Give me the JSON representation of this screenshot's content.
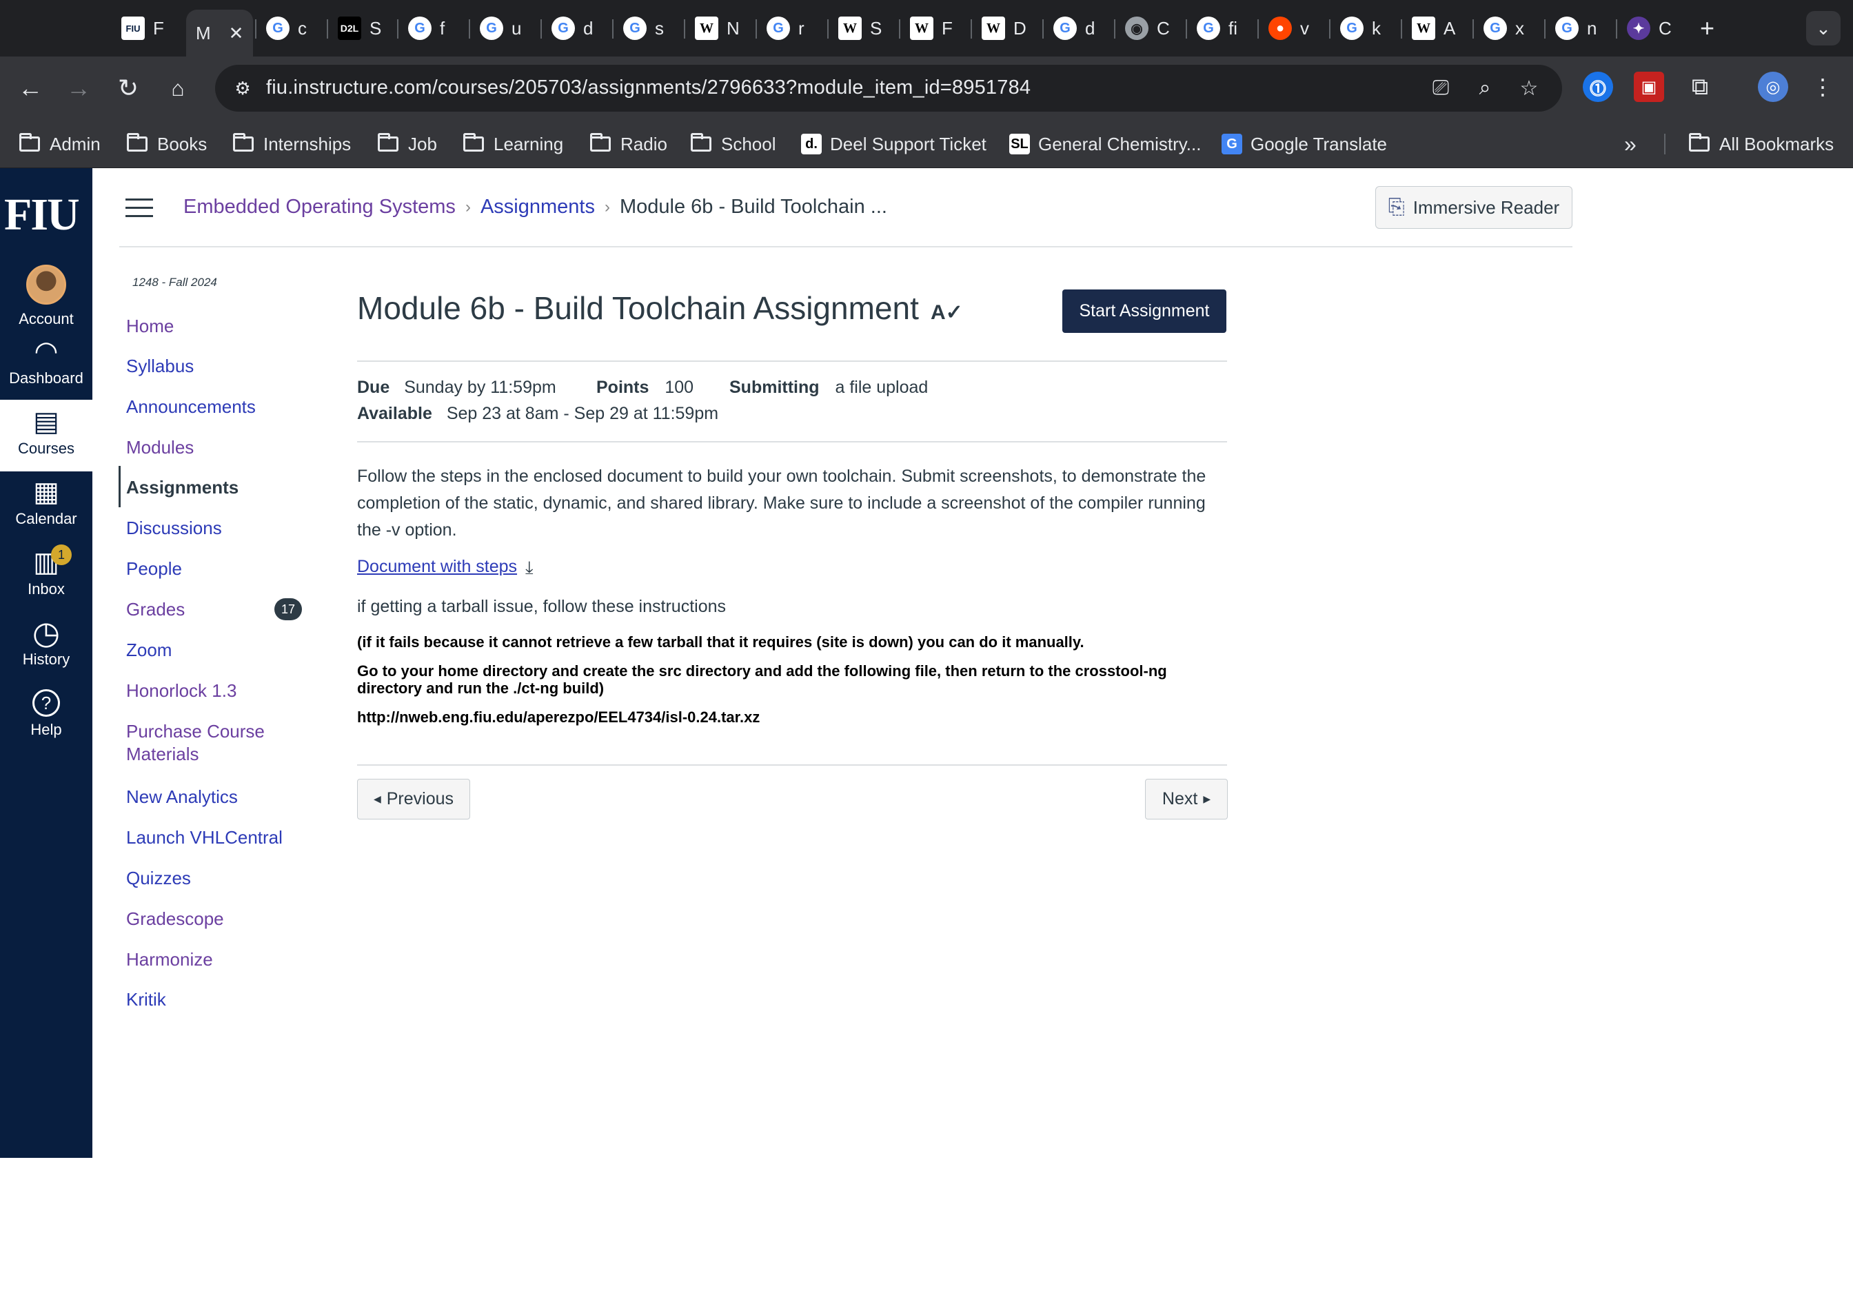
{
  "browser": {
    "tabs": [
      {
        "fav": "FIU",
        "type": "fiu",
        "letter": "F"
      },
      {
        "fav": "",
        "type": "active",
        "letter": "M"
      },
      {
        "fav": "G",
        "type": "g",
        "letter": "c"
      },
      {
        "fav": "D2L",
        "type": "d2l",
        "letter": "S"
      },
      {
        "fav": "G",
        "type": "g",
        "letter": "f"
      },
      {
        "fav": "G",
        "type": "g",
        "letter": "u"
      },
      {
        "fav": "G",
        "type": "g",
        "letter": "d"
      },
      {
        "fav": "G",
        "type": "g",
        "letter": "s"
      },
      {
        "fav": "W",
        "type": "w",
        "letter": "N"
      },
      {
        "fav": "G",
        "type": "g",
        "letter": "r"
      },
      {
        "fav": "W",
        "type": "w",
        "letter": "S"
      },
      {
        "fav": "W",
        "type": "w",
        "letter": "F"
      },
      {
        "fav": "W",
        "type": "w",
        "letter": "D"
      },
      {
        "fav": "G",
        "type": "g",
        "letter": "d"
      },
      {
        "fav": "◉",
        "type": "globe",
        "letter": "C"
      },
      {
        "fav": "G",
        "type": "g",
        "letter": "fi"
      },
      {
        "fav": "●",
        "type": "r",
        "letter": "v"
      },
      {
        "fav": "G",
        "type": "g",
        "letter": "k"
      },
      {
        "fav": "W",
        "type": "w",
        "letter": "A"
      },
      {
        "fav": "G",
        "type": "g",
        "letter": "x"
      },
      {
        "fav": "G",
        "type": "g",
        "letter": "n"
      },
      {
        "fav": "✦",
        "type": "purple",
        "letter": "C"
      }
    ],
    "new_tab": "+",
    "tab_menu": "⌄",
    "url": "fiu.instructure.com/courses/205703/assignments/2796633?module_item_id=8951784",
    "bookmarks": [
      {
        "label": "Admin",
        "kind": "folder"
      },
      {
        "label": "Books",
        "kind": "folder"
      },
      {
        "label": "Internships",
        "kind": "folder"
      },
      {
        "label": "Job",
        "kind": "folder"
      },
      {
        "label": "Learning",
        "kind": "folder"
      },
      {
        "label": "Radio",
        "kind": "folder"
      },
      {
        "label": "School",
        "kind": "folder"
      },
      {
        "label": "Deel Support Ticket",
        "kind": "site",
        "fav": "d."
      },
      {
        "label": "General Chemistry...",
        "kind": "site",
        "fav": "SL"
      },
      {
        "label": "Google Translate",
        "kind": "site",
        "fav": "G"
      }
    ],
    "more_bookmarks": "»",
    "all_bookmarks": "All Bookmarks"
  },
  "global_nav": {
    "logo": "FIU",
    "items": [
      {
        "label": "Account",
        "icon": "avatar"
      },
      {
        "label": "Dashboard",
        "icon": "dashboard-icon"
      },
      {
        "label": "Courses",
        "icon": "courses-icon"
      },
      {
        "label": "Calendar",
        "icon": "calendar-icon"
      },
      {
        "label": "Inbox",
        "icon": "inbox-icon",
        "badge": "1"
      },
      {
        "label": "History",
        "icon": "history-icon"
      },
      {
        "label": "Help",
        "icon": "help-icon"
      }
    ]
  },
  "header": {
    "breadcrumb": [
      "Embedded Operating Systems",
      "Assignments",
      "Module 6b - Build Toolchain ..."
    ],
    "immersive_reader": "Immersive Reader"
  },
  "course_nav": {
    "term": "1248 - Fall 2024",
    "items": [
      {
        "label": "Home"
      },
      {
        "label": "Syllabus"
      },
      {
        "label": "Announcements"
      },
      {
        "label": "Modules"
      },
      {
        "label": "Assignments"
      },
      {
        "label": "Discussions"
      },
      {
        "label": "People"
      },
      {
        "label": "Grades",
        "badge": "17"
      },
      {
        "label": "Zoom"
      },
      {
        "label": "Honorlock 1.3"
      },
      {
        "label": "Purchase Course Materials"
      },
      {
        "label": "New Analytics"
      },
      {
        "label": "Launch VHLCentral"
      },
      {
        "label": "Quizzes"
      },
      {
        "label": "Gradescope"
      },
      {
        "label": "Harmonize"
      },
      {
        "label": "Kritik"
      }
    ]
  },
  "assignment": {
    "title": "Module 6b - Build Toolchain Assignment",
    "start_button": "Start Assignment",
    "due_label": "Due",
    "due_value": "Sunday by 11:59pm",
    "points_label": "Points",
    "points_value": "100",
    "submitting_label": "Submitting",
    "submitting_value": "a file upload",
    "available_label": "Available",
    "available_value": "Sep 23 at 8am - Sep 29 at 11:59pm",
    "description": "Follow the steps in the enclosed document to build your own toolchain. Submit screenshots, to demonstrate the completion of the static, dynamic, and shared library. Make sure to include a screenshot of the compiler running the -v option.",
    "doc_link": "Document with steps",
    "tarball_note": "if getting a tarball issue, follow these instructions",
    "bold_1": "(if it fails because it cannot retrieve a few tarball that it requires (site is down) you can do it manually.",
    "bold_2": "Go to your home directory and create the src directory and add the following file, then return to the crosstool-ng directory  and run the ./ct-ng build)",
    "bold_3": "http://nweb.eng.fiu.edu/aperezpo/EEL4734/isl-0.24.tar.xz",
    "previous": "Previous",
    "next": "Next"
  }
}
